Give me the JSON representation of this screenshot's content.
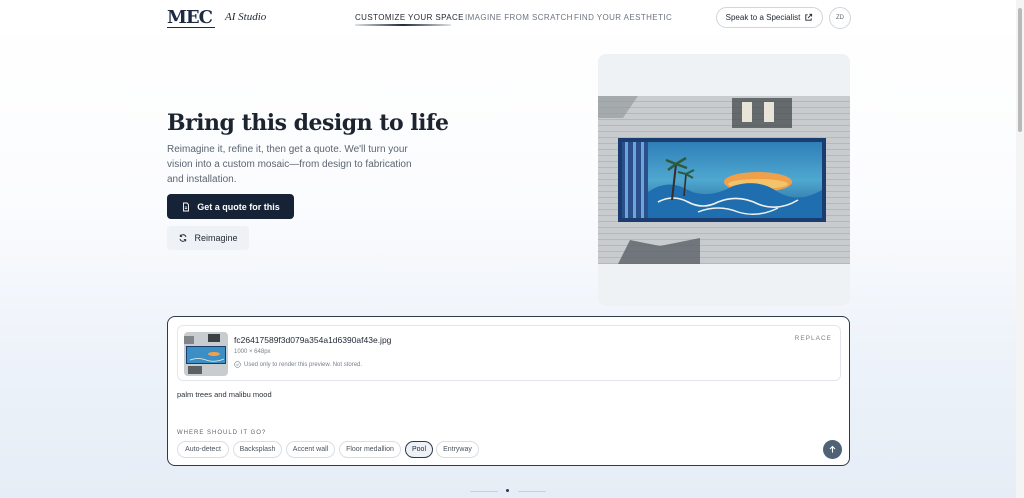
{
  "header": {
    "logo": "MEC",
    "studio_label": "AI Studio",
    "nav": [
      {
        "label": "CUSTOMIZE YOUR SPACE",
        "active": true
      },
      {
        "label": "IMAGINE FROM SCRATCH",
        "active": false
      },
      {
        "label": "FIND YOUR AESTHETIC",
        "active": false
      }
    ],
    "specialist_button": "Speak to a Specialist",
    "avatar_initials": "ZD"
  },
  "hero": {
    "title": "Bring this design to life",
    "description": "Reimagine it, refine it, then get a quote. We'll turn your vision into a custom mosaic—from design to fabrication and installation.",
    "quote_button": "Get a quote for this",
    "reimagine_button": "Reimagine"
  },
  "composer": {
    "file": {
      "name": "fc26417589f3d079a354a1d6390af43e.jpg",
      "dimensions": "1000 × 648px",
      "note": "Used only to render this preview. Not stored.",
      "replace_label": "REPLACE"
    },
    "prompt": "palm trees and malibu mood",
    "location_label": "WHERE SHOULD IT GO?",
    "chips": [
      {
        "label": "Auto-detect",
        "selected": false
      },
      {
        "label": "Backsplash",
        "selected": false
      },
      {
        "label": "Accent wall",
        "selected": false
      },
      {
        "label": "Floor medallion",
        "selected": false
      },
      {
        "label": "Pool",
        "selected": true
      },
      {
        "label": "Entryway",
        "selected": false
      }
    ]
  },
  "colors": {
    "primary": "#162236",
    "accent_border": "#2c3a4e",
    "send_button": "#4f6276"
  },
  "icons": [
    "external-link-icon",
    "document-icon",
    "refresh-icon",
    "check-circle-icon",
    "arrow-up-icon"
  ]
}
